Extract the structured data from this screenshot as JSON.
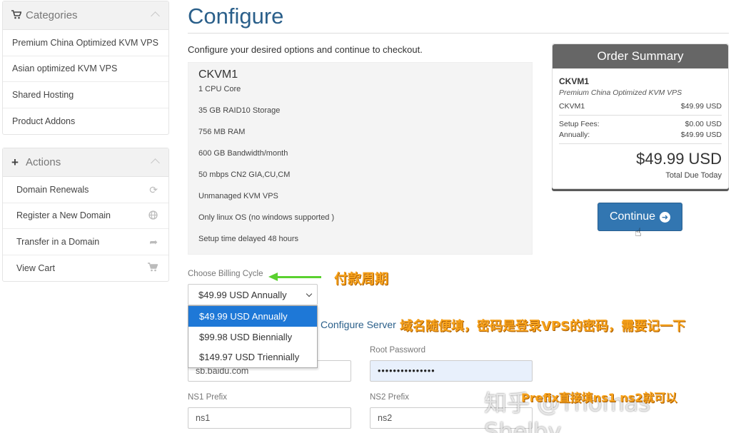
{
  "sidebar": {
    "categories": {
      "title": "Categories",
      "icon": "cart-icon",
      "items": [
        "Premium China Optimized KVM VPS",
        "Asian optimized KVM VPS",
        "Shared Hosting",
        "Product Addons"
      ]
    },
    "actions": {
      "title": "Actions",
      "icon": "plus-icon",
      "items": [
        {
          "label": "Domain Renewals",
          "icon": "refresh-icon"
        },
        {
          "label": "Register a New Domain",
          "icon": "globe-icon"
        },
        {
          "label": "Transfer in a Domain",
          "icon": "share-arrow-icon"
        },
        {
          "label": "View Cart",
          "icon": "cart-icon"
        }
      ]
    }
  },
  "main": {
    "title": "Configure",
    "intro": "Configure your desired options and continue to checkout.",
    "product": {
      "name": "CKVM1",
      "features": [
        "1 CPU Core",
        "35 GB RAID10 Storage",
        "756 MB RAM",
        "600 GB Bandwidth/month",
        "50 mbps CN2 GIA,CU,CM",
        "Unmanaged KVM VPS",
        "Only linux OS (no windows supported )",
        "Setup time delayed 48 hours"
      ]
    },
    "billing": {
      "label": "Choose Billing Cycle",
      "selected": "$49.99 USD Annually",
      "options": [
        "$49.99 USD Annually",
        "$99.98 USD Biennially",
        "$149.97 USD Triennially"
      ]
    },
    "server": {
      "heading": "Configure Server",
      "hostname_value": "sb.baidu.com",
      "root_password_label": "Root Password",
      "root_password_value": "•••••••••••••••",
      "ns1_label": "NS1 Prefix",
      "ns1_value": "ns1",
      "ns2_label": "NS2 Prefix",
      "ns2_value": "ns2"
    }
  },
  "summary": {
    "title": "Order Summary",
    "product_name": "CKVM1",
    "product_group": "Premium China Optimized KVM VPS",
    "line_item": {
      "label": "CKVM1",
      "value": "$49.99 USD"
    },
    "setup_fees": {
      "label": "Setup Fees:",
      "value": "$0.00 USD"
    },
    "annually": {
      "label": "Annually:",
      "value": "$49.99 USD"
    },
    "total": "$49.99 USD",
    "total_label": "Total Due Today"
  },
  "continue_button": "Continue",
  "annotations": {
    "billing_note": "付款周期",
    "server_note": "域名随便填，密码是登录VPS的密码，需要记一下",
    "ns_note": "Prefix直接填ns1 ns2就可以",
    "watermark": "知乎 @Thomas Shelby"
  },
  "colors": {
    "heading_blue": "#2a5f8a",
    "button_blue": "#3276b1",
    "option_selected": "#1e78d7",
    "annotation_orange": "#f7a21b",
    "arrow_green": "#5ad12f"
  }
}
